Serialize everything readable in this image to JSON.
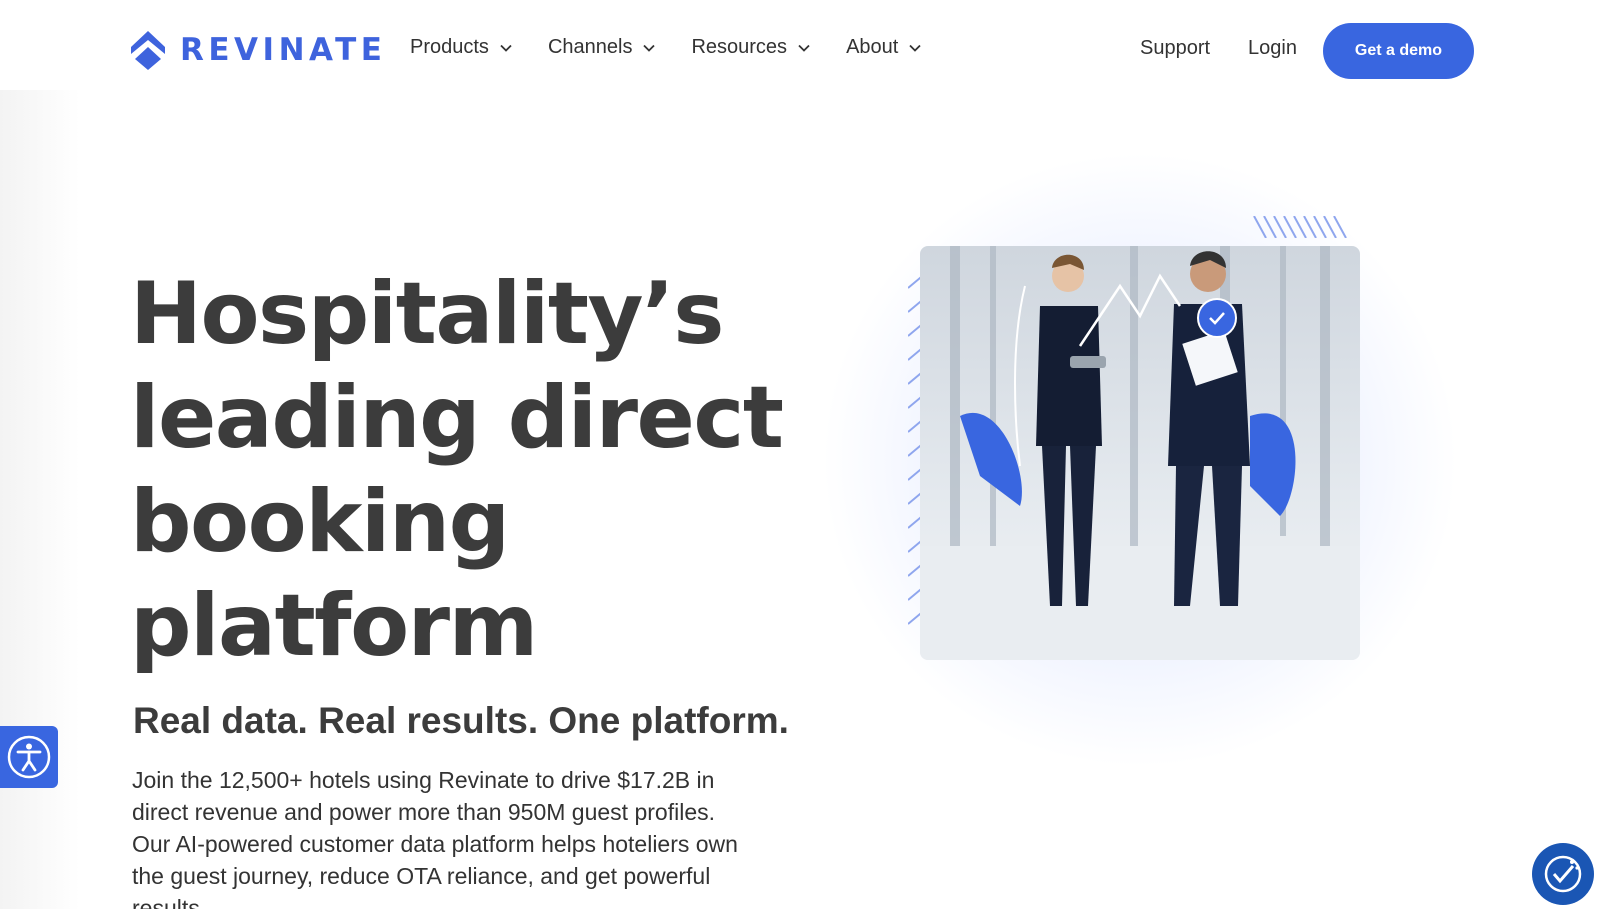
{
  "brand": {
    "name": "REVINATE",
    "color": "#3e63dd"
  },
  "nav": {
    "items": [
      {
        "label": "Products",
        "icon": "chevron-down-icon"
      },
      {
        "label": "Channels",
        "icon": "chevron-down-icon"
      },
      {
        "label": "Resources",
        "icon": "chevron-down-icon"
      },
      {
        "label": "About",
        "icon": "chevron-down-icon"
      }
    ],
    "support_label": "Support",
    "login_label": "Login",
    "cta_label": "Get a demo"
  },
  "hero": {
    "title_lines": [
      "Hospitality’s",
      "leading direct",
      "booking",
      "platform"
    ],
    "subtitle": "Real data. Real results. One platform.",
    "body": "Join the 12,500+ hotels using Revinate to drive $17.2B in direct revenue and power more than 950M guest profiles. Our AI-powered customer data platform helps hoteliers own the guest journey, reduce OTA reliance, and get powerful results."
  },
  "widgets": {
    "accessibility_icon": "accessibility-icon",
    "cookie_icon": "cookie-consent-icon"
  },
  "colors": {
    "accent": "#3966e0",
    "text": "#3c3c3c"
  }
}
